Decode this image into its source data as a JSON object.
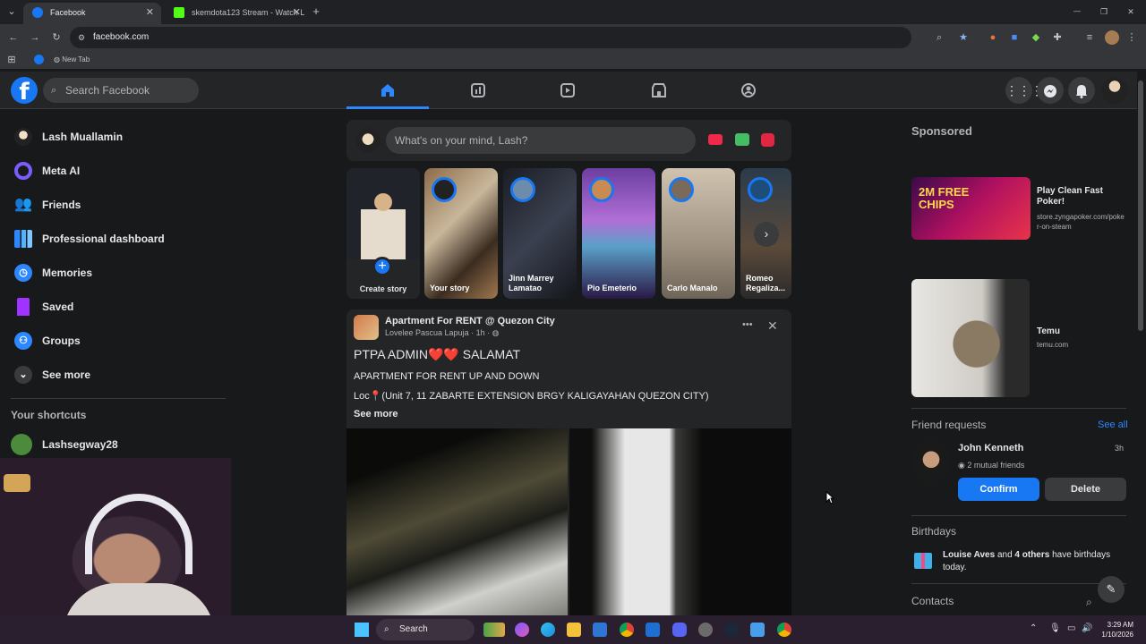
{
  "browser": {
    "tabs": [
      {
        "title": "Facebook",
        "active": true
      },
      {
        "title": "skemdota123 Stream - Watch L",
        "active": false
      }
    ],
    "new_tab": "+",
    "url": "facebook.com",
    "bookmarks": [
      {
        "label": "New Tab"
      }
    ],
    "window_controls": {
      "minimize": "—",
      "restore": "❐",
      "close": "✕"
    }
  },
  "header": {
    "logo": "f",
    "search_placeholder": "Search Facebook",
    "nav_tabs": [
      "home-icon",
      "dashboard-icon",
      "reels-icon",
      "marketplace-icon",
      "profile-icon"
    ],
    "accent": "#2d88ff"
  },
  "left_nav": {
    "items": [
      {
        "label": "Lash Muallamin",
        "icon": "avatar"
      },
      {
        "label": "Meta AI",
        "icon": "meta-ai-icon"
      },
      {
        "label": "Friends",
        "icon": "friends-icon"
      },
      {
        "label": "Professional dashboard",
        "icon": "dashboard-icon"
      },
      {
        "label": "Memories",
        "icon": "memories-icon"
      },
      {
        "label": "Saved",
        "icon": "bookmark-icon"
      },
      {
        "label": "Groups",
        "icon": "groups-icon"
      },
      {
        "label": "See more",
        "icon": "chevron-down-icon"
      }
    ],
    "shortcuts_title": "Your shortcuts",
    "shortcuts": [
      {
        "label": "Lashsegway28"
      }
    ]
  },
  "composer": {
    "placeholder": "What's on your mind, Lash?"
  },
  "stories": [
    {
      "name": "Create story"
    },
    {
      "name": "Your story"
    },
    {
      "name": "Jinn Marrey Lamatao"
    },
    {
      "name": "Pio Emeterio"
    },
    {
      "name": "Carlo Manalo"
    },
    {
      "name": "Romeo Regaliza..."
    }
  ],
  "post": {
    "group": "Apartment For RENT @ Quezon City",
    "author": "Lovelee Pascua Lapuja",
    "time": "1h",
    "title": "PTPA ADMIN❤️❤️ SALAMAT",
    "line1": "APARTMENT FOR RENT UP AND DOWN",
    "line2": "Loc📍(Unit 7, 11 ZABARTE EXTENSION BRGY KALIGAYAHAN QUEZON CITY)",
    "see_more": "See more",
    "more_options": "•••",
    "close": "✕"
  },
  "right": {
    "sponsored_title": "Sponsored",
    "ads": [
      {
        "title": "Play Clean Fast Poker!",
        "url": "store.zyngapoker.com/poker-on-steam",
        "image_text": "2M FREE CHIPS"
      },
      {
        "title": "Temu",
        "url": "temu.com"
      }
    ],
    "friend_requests": {
      "title": "Friend requests",
      "see_all": "See all",
      "name": "John Kenneth",
      "time": "3h",
      "mutual": "2 mutual friends",
      "confirm": "Confirm",
      "delete": "Delete"
    },
    "birthdays": {
      "title": "Birthdays",
      "name": "Louise Aves",
      "and": "and",
      "others": "4 others",
      "rest": "have birthdays today."
    },
    "contacts_title": "Contacts"
  },
  "taskbar": {
    "search": "Search",
    "time": "3:29 AM",
    "date": "1/10/2026"
  }
}
